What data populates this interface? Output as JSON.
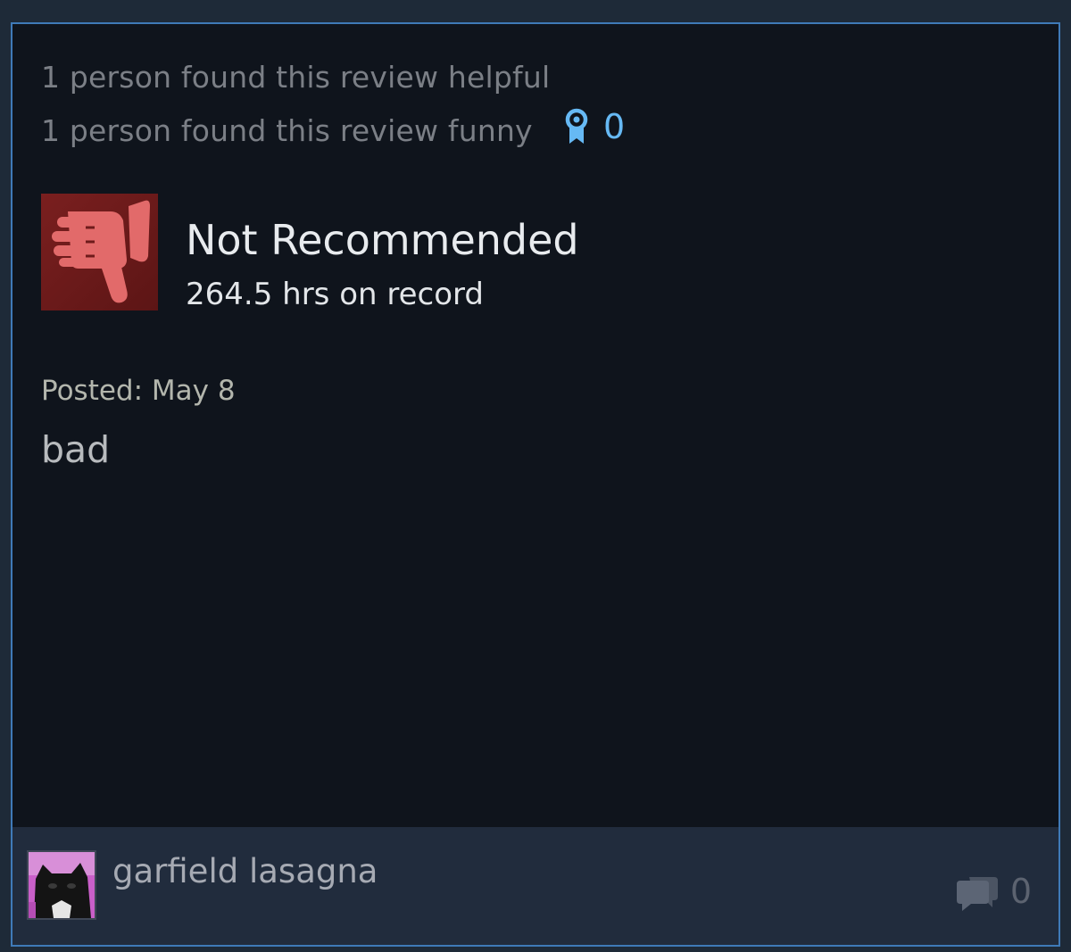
{
  "review": {
    "helpful_text": "1 person found this review helpful",
    "funny_text": "1 person found this review funny",
    "award_icon": "award-ribbon-icon",
    "award_count": "0",
    "thumb_icon": "thumbs-down-icon",
    "verdict": "Not Recommended",
    "hours": "264.5 hrs on record",
    "posted": "Posted: May 8",
    "text": "bad"
  },
  "author": {
    "name": "garfield lasagna",
    "avatar_icon": "cat-avatar",
    "comment_icon": "comment-bubbles-icon",
    "comment_count": "0"
  },
  "colors": {
    "page_background": "#1e2a38",
    "card_border": "#3f7ab8",
    "card_background": "#0f141c",
    "footer_background": "#212c3d",
    "award_accent": "#66b9f4",
    "thumb_background": "#6e1b1b",
    "thumb_icon": "#e26a6a"
  }
}
